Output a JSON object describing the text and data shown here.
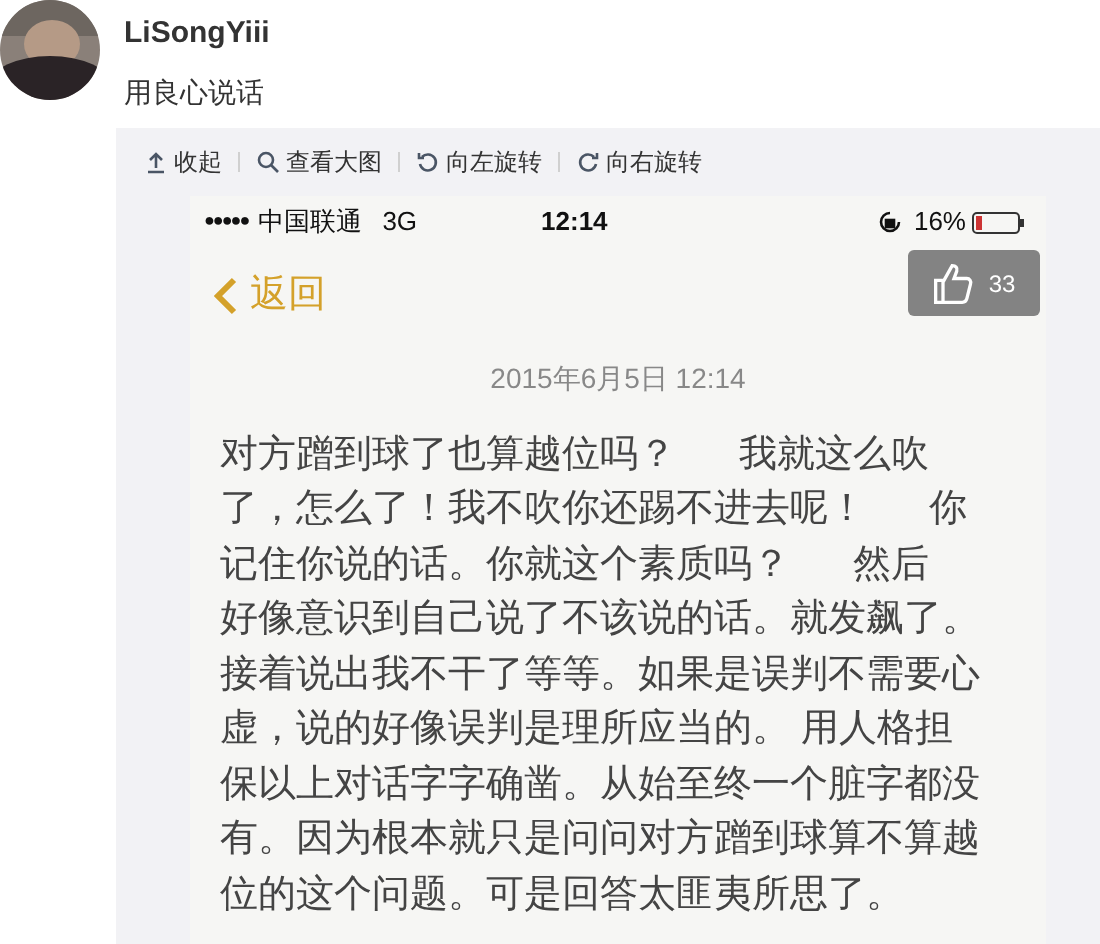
{
  "post": {
    "author": "LiSongYiii",
    "text": "用良心说话"
  },
  "toolbar": [
    {
      "kind": "collapse",
      "label": "收起"
    },
    {
      "kind": "zoom",
      "label": "查看大图"
    },
    {
      "kind": "rotate_left",
      "label": "向左旋转"
    },
    {
      "kind": "rotate_right",
      "label": "向右旋转"
    }
  ],
  "phone": {
    "status_bar": {
      "signal": "●●●●●",
      "carrier": "中国联通",
      "network": "3G",
      "time": "12:14",
      "battery": "16%"
    },
    "back": "返回",
    "date": "2015年6月5日 12:14",
    "lines": [
      "对方蹭到球了也算越位吗？      我就这么吹",
      "了，怎么了！我不吹你还踢不进去呢！      你",
      "记住你说的话。你就这个素质吗？      然后",
      "好像意识到自己说了不该说的话。就发飙了。",
      "接着说出我不干了等等。如果是误判不需要心",
      "虚，说的好像误判是理所应当的。 用人格担",
      "保以上对话字字确凿。从始至终一个脏字都没",
      "有。因为根本就只是问问对方蹭到球算不算越",
      "位的这个问题。可是回答太匪夷所思了。"
    ]
  },
  "like": {
    "count": "33"
  }
}
